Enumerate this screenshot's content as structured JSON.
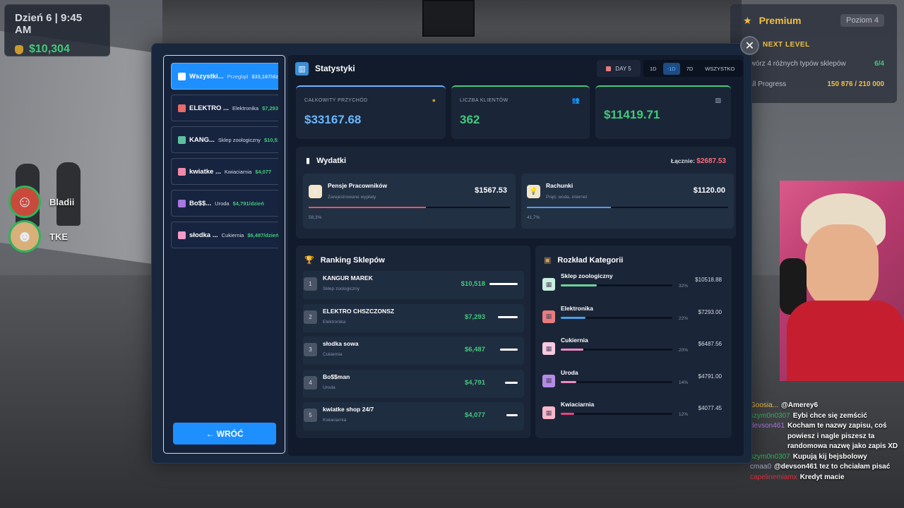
{
  "hud": {
    "day": "Dzień 6 | 9:45 AM",
    "money": "$10,304"
  },
  "players": [
    {
      "name": "Bladii"
    },
    {
      "name": "TKE"
    }
  ],
  "premium": {
    "title": "Premium",
    "level": "Poziom 4",
    "next_level": "NEXT LEVEL",
    "task_label": "Otwórz 4 różnych typów sklepów",
    "task_progress": "6/4",
    "mall_label": "Mall Progress",
    "mall_value": "150 876 / 210 000"
  },
  "sidebar": {
    "items": [
      {
        "name": "Wszystki...",
        "type": "Przegląd",
        "income": "$33,167/dz",
        "color": "#ffffff"
      },
      {
        "name": "ELEKTRO ...",
        "type": "Elektronika",
        "income": "$7,293/dz",
        "color": "#e86a6a"
      },
      {
        "name": "KANG...",
        "type": "Sklep zoologiczny",
        "income": "$10,518/dz",
        "color": "#5fc0a0"
      },
      {
        "name": "kwiatke ...",
        "type": "Kwiaciarnia",
        "income": "$4,077",
        "color": "#f08aa8"
      },
      {
        "name": "Bo$$...",
        "type": "Uroda",
        "income": "$4,791/dzień",
        "color": "#a877e0"
      },
      {
        "name": "słodka ...",
        "type": "Cukiernia",
        "income": "$6,487/dzień",
        "color": "#f29ac8"
      }
    ],
    "back_label": "← WRÓĆ"
  },
  "header": {
    "title": "Statystyki",
    "day": "DAY 5",
    "ranges": [
      "1D",
      "-1D",
      "7D",
      "WSZYSTKO"
    ],
    "active_range": 1
  },
  "cards": [
    {
      "label": "CAŁKOWITY PRZYCHÓD",
      "value": "$33167.68",
      "color": "#6ab6ff"
    },
    {
      "label": "LICZBA KLIENTÓW",
      "value": "362",
      "color": "#43c97b"
    },
    {
      "label": "",
      "value": "$11419.71",
      "color": "#43c97b"
    }
  ],
  "expenses": {
    "title": "Wydatki",
    "total_label": "Łącznie:",
    "total": "$2687.53",
    "items": [
      {
        "name": "Pensje Pracowników",
        "desc": "Zarejestrowane wypłaty",
        "value": "$1567.53",
        "pct_label": "58,3%",
        "pct": 58.3,
        "color": "#e8566a"
      },
      {
        "name": "Rachunki",
        "desc": "Prąd, woda, internet",
        "value": "$1120.00",
        "pct_label": "41,7%",
        "pct": 41.7,
        "color": "#4a9fe8"
      }
    ]
  },
  "ranking": {
    "title": "Ranking Sklepów",
    "items": [
      {
        "rank": "1",
        "name": "KANGUR MAREK",
        "type": "Sklep zoologiczny",
        "income": "$10,518",
        "share": 1.0
      },
      {
        "rank": "2",
        "name": "ELEKTRO CHSZCZONSZ",
        "type": "Elektronika",
        "income": "$7,293",
        "share": 0.69
      },
      {
        "rank": "3",
        "name": "słodka sowa",
        "type": "Cukiernia",
        "income": "$6,487",
        "share": 0.62
      },
      {
        "rank": "4",
        "name": "Bo$$man",
        "type": "Uroda",
        "income": "$4,791",
        "share": 0.46
      },
      {
        "rank": "5",
        "name": "kwiatke shop 24/7",
        "type": "Kwiaciarnia",
        "income": "$4,077",
        "share": 0.39
      }
    ]
  },
  "categories": {
    "title": "Rozkład Kategorii",
    "items": [
      {
        "name": "Sklep zoologiczny",
        "pct_label": "32%",
        "pct": 32,
        "value": "$10518.88",
        "color": "#6ed39a",
        "bg": "#c9efe0"
      },
      {
        "name": "Elektronika",
        "pct_label": "22%",
        "pct": 22,
        "value": "$7293.00",
        "color": "#4a9fe8",
        "bg": "#e87c7c"
      },
      {
        "name": "Cukiernia",
        "pct_label": "20%",
        "pct": 20,
        "value": "$6487.56",
        "color": "#f08ac2",
        "bg": "#f7c8e0"
      },
      {
        "name": "Uroda",
        "pct_label": "14%",
        "pct": 14,
        "value": "$4791.00",
        "color": "#f08ac2",
        "bg": "#b58be8"
      },
      {
        "name": "Kwiaciarnia",
        "pct_label": "12%",
        "pct": 12,
        "value": "$4077.45",
        "color": "#e8457a",
        "bg": "#f7b8cc"
      }
    ]
  },
  "chat": [
    {
      "user": "Goosia...",
      "text": "@Amerey6",
      "color": "#f0c044"
    },
    {
      "user": "szym0n0307",
      "text": "Eybi chce się zemścić",
      "color": "#2fb45b"
    },
    {
      "user": "devson461",
      "text": "Kocham te nazwy zapisu, coś powiesz i nagle piszesz ta randomowa nazwę jako zapis XD",
      "color": "#a877e0"
    },
    {
      "user": "szym0n0307",
      "text": "Kupują kij bejsbolowy",
      "color": "#2fb45b"
    },
    {
      "user": "cmaa0",
      "text": "@devson461 tez to chciałam pisać",
      "color": "#9aa6ba"
    },
    {
      "user": "capelinemiamx",
      "text": "Kredyt macie",
      "color": "#d9303a"
    }
  ]
}
